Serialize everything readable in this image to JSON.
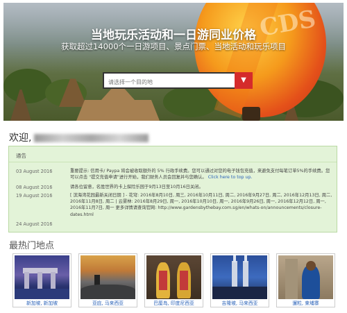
{
  "hero": {
    "title": "当地玩乐活动和一日游同业价格",
    "subtitle": "获取超过14000个一日游项目、景点门票、当地活动和玩乐项目",
    "search_placeholder": "请选择一个目的地",
    "dropdown_icon": "chevron-down-icon"
  },
  "welcome": {
    "label": "欢迎,"
  },
  "notice": {
    "header": "通告",
    "entries": [
      {
        "date": "03 August 2016",
        "text": "重要提示: 信用卡/ Paypa 将会被收取额外的 5% 行政手续费。您可以通过对您的电子钱包充值，来避免支付每笔订单5%的手续费。您可以点击 \"提交充值申请\"进行开始，我们财务人员会回复并与您确认。",
        "link": "Click here to top up."
      },
      {
        "date": "08 August 2016",
        "text": "请各位留意，名胜世界的卡上探险乐园于9月13日至10月16日关闭。"
      },
      {
        "date": "19 August 2016",
        "text": "[ 滨海湾花园最新关闭日期 ] - 花穹: 2016年8月10日, 周三, 2016年10月11日, 周二, 2016年9月27日, 周二, 2016年12月13日, 周二, 2016年11月8日, 周二 | 云雾林: 2016年8月29日, 周一, 2016年10月10日, 周一, 2016年9月26日, 周一, 2016年12月12日, 周一, 2016年11月7日, 周一 更多详情请查询官网: http://www.gardensbythebay.com.sg/en/whats-on/announcements/closure-dates.html"
      },
      {
        "date": "24 August 2016",
        "text": ""
      }
    ]
  },
  "popular": {
    "title": "最热门地点",
    "places": [
      {
        "label": "新加坡, 新加坡"
      },
      {
        "label": "亚庇, 马来西亚"
      },
      {
        "label": "巴厘岛, 印度尼西亚"
      },
      {
        "label": "吉隆坡, 马来西亚"
      },
      {
        "label": "暹粒, 柬埔寨"
      }
    ]
  }
}
